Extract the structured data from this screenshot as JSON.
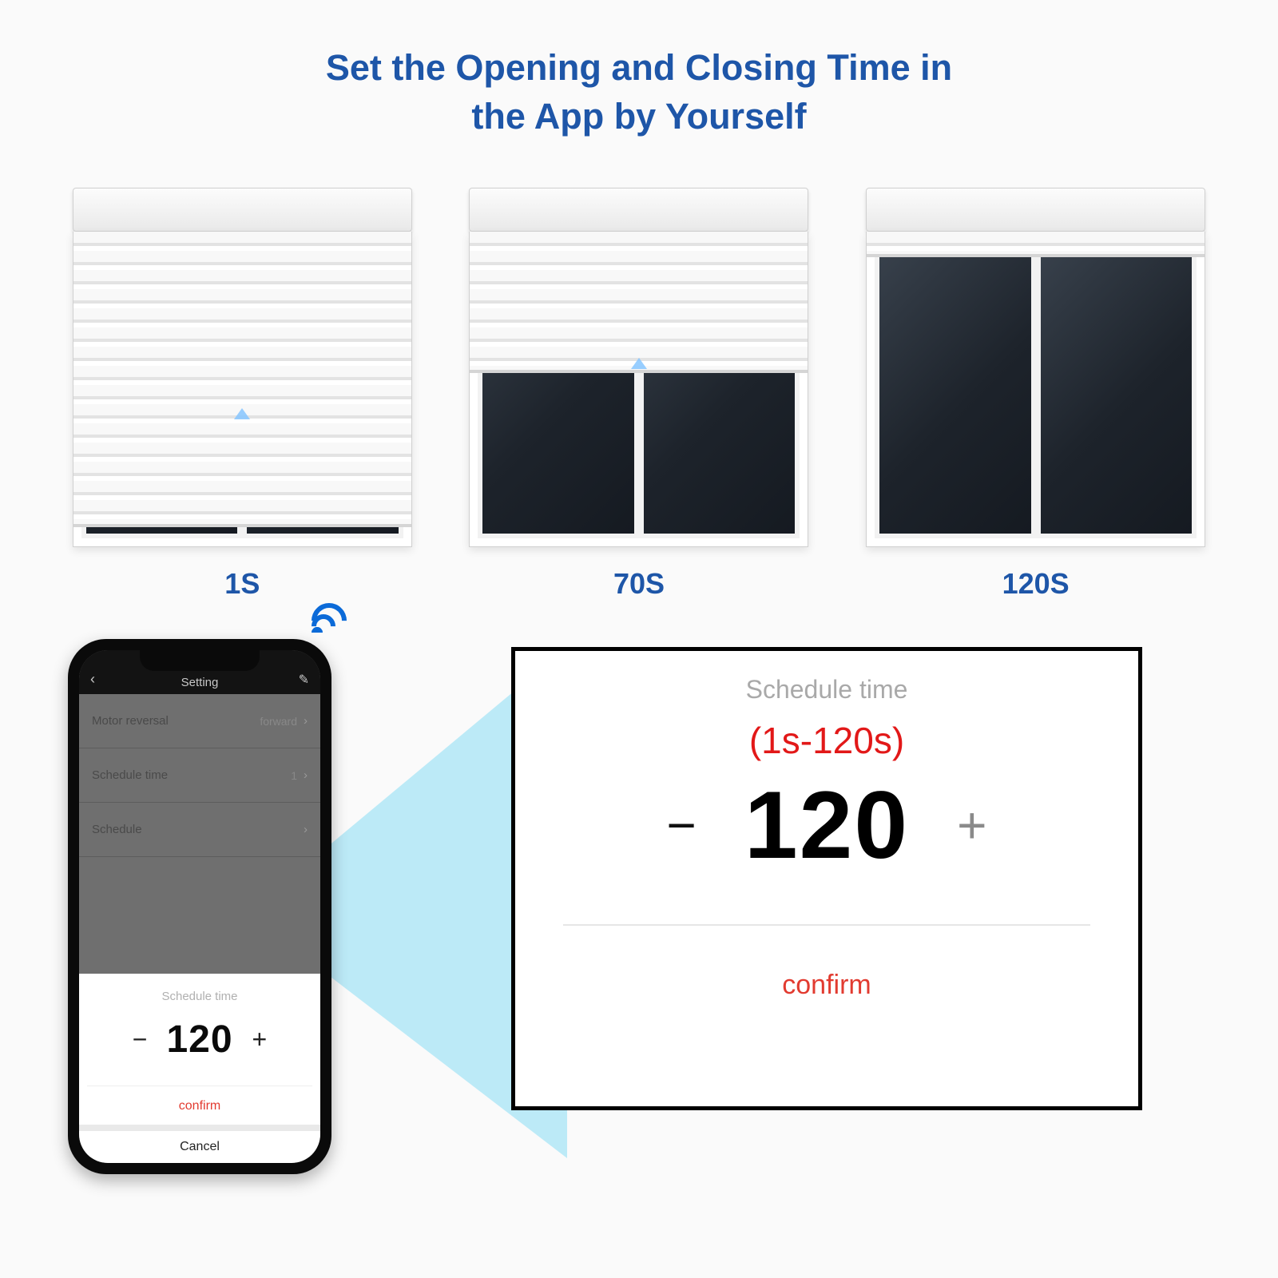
{
  "title_line1": "Set the Opening and Closing Time in",
  "title_line2": "the App by Yourself",
  "shutters": {
    "label_1s": "1S",
    "label_70s": "70S",
    "label_120s": "120S"
  },
  "phone": {
    "header": "Setting",
    "rows": [
      {
        "label": "Motor reversal",
        "value": "forward"
      },
      {
        "label": "Schedule time",
        "value": "1"
      },
      {
        "label": "Schedule",
        "value": ""
      }
    ],
    "sheet_title": "Schedule time",
    "sheet_value": "120",
    "confirm": "confirm",
    "cancel": "Cancel"
  },
  "panel": {
    "title": "Schedule time",
    "range": "(1s-120s)",
    "value": "120",
    "confirm": "confirm"
  },
  "symbols": {
    "minus": "−",
    "plus": "+",
    "chev_left": "‹",
    "chev_right": "›",
    "pencil": "✎"
  }
}
